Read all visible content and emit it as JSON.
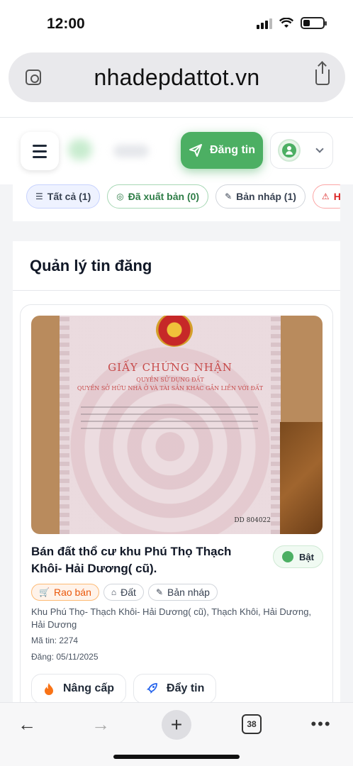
{
  "status_bar": {
    "time": "12:00"
  },
  "browser": {
    "url": "nhadepdattot.vn",
    "tab_count": "38"
  },
  "header": {
    "post_button_label": "Đăng tin"
  },
  "filter_tabs": [
    {
      "label": "Tất cả (1)",
      "icon": "list-icon"
    },
    {
      "label": "Đã xuất bản (0)",
      "icon": "check-circle-icon"
    },
    {
      "label": "Bản nháp (1)",
      "icon": "edit-icon"
    },
    {
      "label": "H",
      "icon": "warning-icon"
    }
  ],
  "panel": {
    "title": "Quản lý tin đăng"
  },
  "listing": {
    "photo": {
      "heading": "GIẤY CHỨNG NHẬN",
      "sub1": "QUYỀN SỬ DỤNG ĐẤT",
      "sub2": "QUYỀN SỞ HỮU NHÀ Ở VÀ TÀI SẢN KHÁC GẮN LIỀN VỚI ĐẤT",
      "serial": "DD 804022"
    },
    "title": "Bán đất thổ cư khu Phú Thọ Thạch Khôi- Hải Dương( cũ).",
    "toggle_label": "Bật",
    "chips": [
      {
        "label": "Rao bán",
        "icon": "cart-icon"
      },
      {
        "label": "Đất",
        "icon": "home-icon"
      },
      {
        "label": "Bản nháp",
        "icon": "edit-icon"
      }
    ],
    "address": "Khu Phú Thọ- Thạch Khôi- Hải Dương( cũ), Thạch Khôi, Hải Dương, Hải Dương",
    "code": "Mã tin: 2274",
    "date": "Đăng: 05/11/2025",
    "actions": [
      {
        "label": "Nâng cấp",
        "icon": "fire-icon"
      },
      {
        "label": "Đẩy tin",
        "icon": "rocket-icon"
      }
    ]
  },
  "colors": {
    "brand_green": "#4caf63",
    "orange": "#ea580c"
  }
}
